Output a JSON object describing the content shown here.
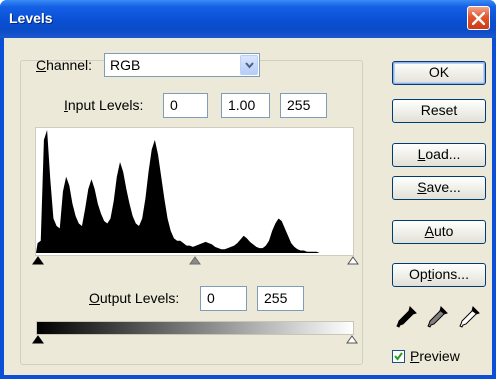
{
  "window": {
    "title": "Levels"
  },
  "channel": {
    "label_prefix": "",
    "label_underline": "C",
    "label_rest": "hannel:",
    "value": "RGB"
  },
  "input_levels": {
    "label_underline": "I",
    "label_rest": "nput Levels:",
    "black": "0",
    "gamma": "1.00",
    "white": "255"
  },
  "output_levels": {
    "label_underline": "O",
    "label_rest": "utput Levels:",
    "black": "0",
    "white": "255"
  },
  "buttons": {
    "ok": "OK",
    "reset": "Reset",
    "load_ul": "L",
    "load_rest": "oad...",
    "save_ul": "S",
    "save_rest": "ave...",
    "auto_ul": "A",
    "auto_rest": "uto",
    "options_pre": "Op",
    "options_ul": "t",
    "options_rest": "ions..."
  },
  "preview": {
    "checked": true,
    "label_ul": "P",
    "label_rest": "review"
  },
  "eyedroppers": [
    "black-eyedropper-icon",
    "gray-eyedropper-icon",
    "white-eyedropper-icon"
  ],
  "histogram": {
    "bins": [
      8,
      10,
      92,
      100,
      60,
      28,
      22,
      20,
      50,
      62,
      55,
      40,
      30,
      24,
      22,
      36,
      52,
      60,
      52,
      40,
      32,
      26,
      24,
      28,
      42,
      62,
      74,
      66,
      52,
      40,
      30,
      24,
      22,
      28,
      44,
      66,
      84,
      92,
      80,
      62,
      44,
      28,
      18,
      12,
      10,
      10,
      8,
      6,
      6,
      5,
      6,
      7,
      8,
      9,
      8,
      7,
      5,
      4,
      3,
      3,
      4,
      5,
      6,
      8,
      11,
      14,
      12,
      9,
      7,
      5,
      4,
      4,
      6,
      10,
      18,
      24,
      28,
      26,
      20,
      14,
      8,
      5,
      3,
      2,
      2,
      1,
      1,
      1,
      1,
      0,
      0,
      0,
      0,
      0,
      0,
      0,
      0,
      0,
      0,
      0
    ]
  }
}
